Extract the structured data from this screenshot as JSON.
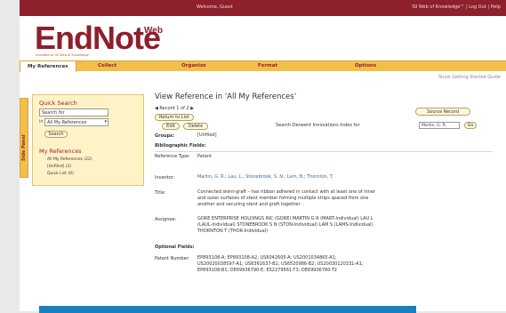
{
  "topbar": {
    "welcome": "Welcome, Guest",
    "links": "ISI Web of Knowledge™  |  Log Out  |  Help"
  },
  "logo": {
    "name": "EndNote",
    "suffix": "Web",
    "powered_by": "provided by ISI Web of Knowledge"
  },
  "tabs": [
    "My References",
    "Collect",
    "Organize",
    "Format",
    "Options"
  ],
  "guide_link": "Show Getting Started Guide",
  "side_tab": "Side Panel",
  "quick_search": {
    "title": "Quick Search",
    "input_value": "Search for",
    "in_label": "in",
    "select_value": "All My References",
    "button": "Search"
  },
  "my_references": {
    "title": "My References",
    "items": [
      "All My References (22)",
      "[Unfiled] (2)",
      "Quick List (0)"
    ]
  },
  "main": {
    "title": "View Reference in 'All My References'",
    "record_nav": "◀ Record 1 of 2 ▶",
    "return_button": "Return to List",
    "edit_button": "Edit",
    "delete_button": "Delete",
    "source_button": "Source Record",
    "derwent_label": "Search Derwent Innovations Index for",
    "derwent_select": "Martin, G. R.",
    "go_button": "Go",
    "groups_label": "Groups:",
    "groups_value": "[Unfiled]",
    "bib_heading": "Bibliographic Fields:",
    "ref_type_label": "Reference Type:",
    "ref_type_value": "Patent",
    "inventor_label": "Inventor:",
    "inventor_value": "Martin, G. R.; Lau, L.; Stonebrook, S. N.; Lam, B.; Thornton, T.",
    "title_label": "Title:",
    "title_value_1": "Connected stent-graft – has ribbon adhered in contact with at least one of inner",
    "title_value_2": "and outer surfaces of stent member forming multiple strips spaced from one",
    "title_value_3": "another and securing stent and graft together",
    "assignee_label": "Assignee:",
    "assignee_value_1": "GORE ENTERPRISE HOLDINGS INC (GORE) MARTIN G R (MART-Individual) LAU L",
    "assignee_value_2": "(LAUL-Individual) STONEBROOK S N (STON-Individual) LAM S (LAMS-Individual)",
    "assignee_value_3": "THORNTON T (THOR-Individual)",
    "optional_heading": "Optional Fields:",
    "patent_label": "Patent Number:",
    "patent_value_1": "EP893108-A; EP893108-A2; US6042605-A; US2001034865-A1;",
    "patent_value_2": "US20020038597-A1; US6361637-B1; US6520986-B2; US20030120331-A1;",
    "patent_value_3": "EP893108-B1; DE69936790-E; ES2279561-T3; DE69936780-T2"
  },
  "colors": {
    "brand": "#8e1f2c",
    "tab_bar": "#f2c04a",
    "panel": "#fdf3c7",
    "link": "#3a67a8"
  }
}
